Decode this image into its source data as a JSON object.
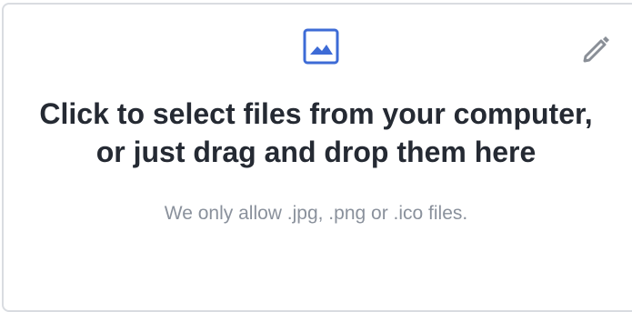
{
  "dropzone": {
    "headline_line1": "Click to select files from your computer,",
    "headline_line2": "or just drag and drop them here",
    "hint": "We only allow .jpg, .png or .ico files.",
    "icon": "image-icon",
    "edit_icon": "pencil-icon"
  },
  "colors": {
    "accent": "#3d6bd6",
    "headline": "#252a33",
    "hint": "#8a919c",
    "border": "#d9dce1",
    "edit_icon": "#8a8f97"
  }
}
